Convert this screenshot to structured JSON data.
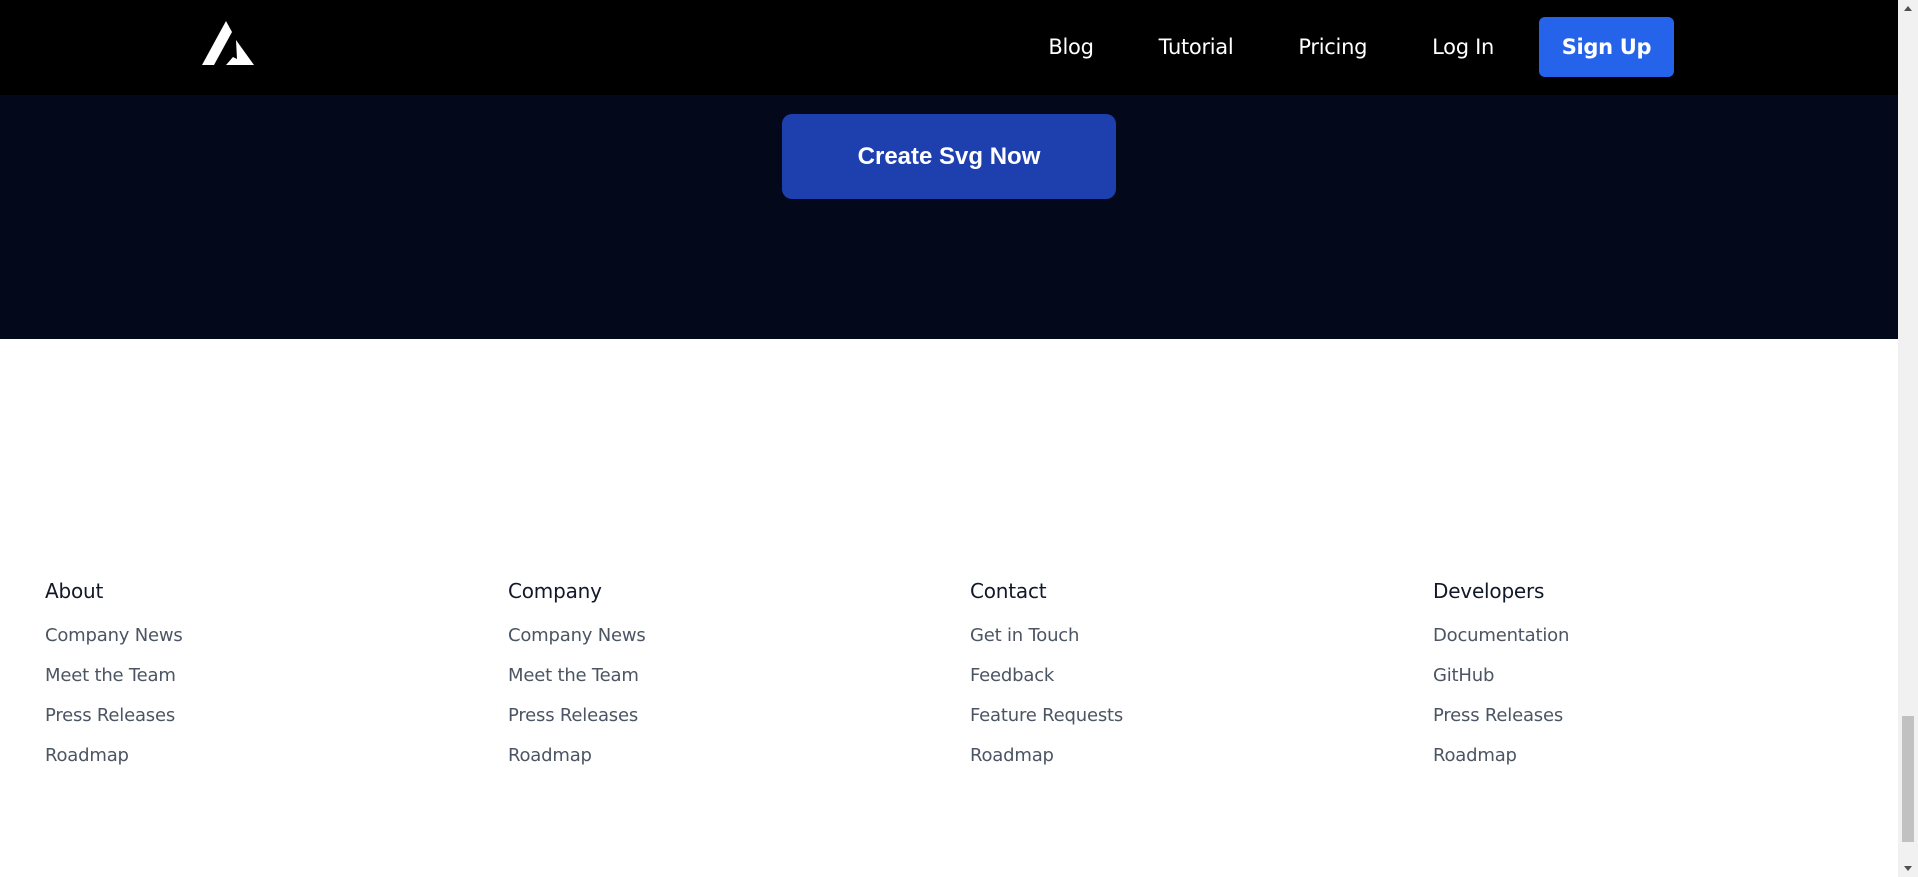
{
  "nav": {
    "logo_icon": "triangle-logo-icon",
    "links": [
      "Blog",
      "Tutorial",
      "Pricing",
      "Log In"
    ],
    "signup_label": "Sign Up"
  },
  "hero": {
    "cta_label": "Create Svg Now"
  },
  "footer": {
    "columns": [
      {
        "heading": "About",
        "links": [
          "Company News",
          "Meet the Team",
          "Press Releases",
          "Roadmap"
        ]
      },
      {
        "heading": "Company",
        "links": [
          "Company News",
          "Meet the Team",
          "Press Releases",
          "Roadmap"
        ]
      },
      {
        "heading": "Contact",
        "links": [
          "Get in Touch",
          "Feedback",
          "Feature Requests",
          "Roadmap"
        ]
      },
      {
        "heading": "Developers",
        "links": [
          "Documentation",
          "GitHub",
          "Press Releases",
          "Roadmap"
        ]
      }
    ]
  },
  "colors": {
    "nav_bg": "#000000",
    "hero_bg": "#03081a",
    "cta_bg": "#1e40af",
    "signup_bg": "#2563eb",
    "footer_bg": "#ffffff",
    "footer_link": "#4b5563"
  },
  "scrollbar": {
    "up_icon": "scroll-up-arrow-icon",
    "down_icon": "scroll-down-arrow-icon",
    "scroll_position": 0.92
  }
}
